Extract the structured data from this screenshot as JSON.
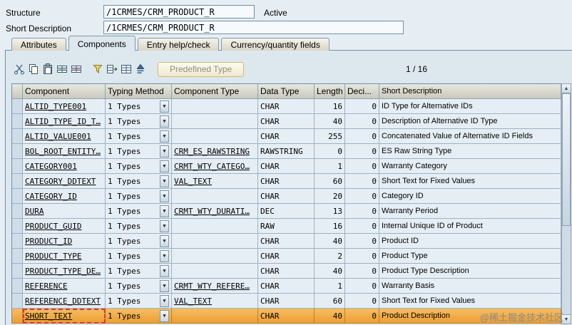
{
  "form": {
    "structure_label": "Structure",
    "structure_value": "/1CRMES/CRM_PRODUCT_R",
    "status": "Active",
    "short_description_label": "Short Description",
    "short_description_value": "/1CRMES/CRM_PRODUCT_R"
  },
  "tabs": [
    {
      "label": "Attributes",
      "active": false
    },
    {
      "label": "Components",
      "active": true
    },
    {
      "label": "Entry help/check",
      "active": false
    },
    {
      "label": "Currency/quantity fields",
      "active": false
    }
  ],
  "toolbar": {
    "icons_edit": [
      "cut-icon",
      "copy-icon",
      "paste-icon",
      "insert-row-icon",
      "delete-row-icon"
    ],
    "icons_view": [
      "filter-icon",
      "table-expand-icon",
      "table-icon",
      "sort-ascending-icon"
    ],
    "predefined_type_label": "Predefined Type",
    "position_indicator": "1 / 16"
  },
  "table": {
    "columns": [
      "Component",
      "Typing Method",
      "Component Type",
      "Data Type",
      "Length",
      "Deci...",
      "Short Description"
    ],
    "rows": [
      {
        "component": "ALTID_TYPE001",
        "typing": "1 Types",
        "component_type": "",
        "data_type": "CHAR",
        "length": "16",
        "decimals": "0",
        "description": "ID Type for Alternative IDs"
      },
      {
        "component": "ALTID_TYPE_ID_T…",
        "typing": "1 Types",
        "component_type": "",
        "data_type": "CHAR",
        "length": "40",
        "decimals": "0",
        "description": "Description of Alternative ID Type"
      },
      {
        "component": "ALTID_VALUE001",
        "typing": "1 Types",
        "component_type": "",
        "data_type": "CHAR",
        "length": "255",
        "decimals": "0",
        "description": "Concatenated Value of Alternative ID Fields"
      },
      {
        "component": "BOL_ROOT_ENTITY…",
        "typing": "1 Types",
        "component_type": "CRM_ES_RAWSTRING",
        "data_type": "RAWSTRING",
        "length": "0",
        "decimals": "0",
        "description": "ES Raw String Type"
      },
      {
        "component": "CATEGORY001",
        "typing": "1 Types",
        "component_type": "CRMT_WTY_CATEGO…",
        "data_type": "CHAR",
        "length": "1",
        "decimals": "0",
        "description": "Warranty Category"
      },
      {
        "component": "CATEGORY_DDTEXT",
        "typing": "1 Types",
        "component_type": "VAL_TEXT",
        "data_type": "CHAR",
        "length": "60",
        "decimals": "0",
        "description": "Short Text for Fixed Values"
      },
      {
        "component": "CATEGORY_ID",
        "typing": "1 Types",
        "component_type": "",
        "data_type": "CHAR",
        "length": "20",
        "decimals": "0",
        "description": "Category ID"
      },
      {
        "component": "DURA",
        "typing": "1 Types",
        "component_type": "CRMT_WTY_DURATI…",
        "data_type": "DEC",
        "length": "13",
        "decimals": "0",
        "description": "Warranty Period"
      },
      {
        "component": "PRODUCT_GUID",
        "typing": "1 Types",
        "component_type": "",
        "data_type": "RAW",
        "length": "16",
        "decimals": "0",
        "description": "Internal Unique ID of Product"
      },
      {
        "component": "PRODUCT_ID",
        "typing": "1 Types",
        "component_type": "",
        "data_type": "CHAR",
        "length": "40",
        "decimals": "0",
        "description": "Product ID"
      },
      {
        "component": "PRODUCT_TYPE",
        "typing": "1 Types",
        "component_type": "",
        "data_type": "CHAR",
        "length": "2",
        "decimals": "0",
        "description": "Product Type"
      },
      {
        "component": "PRODUCT_TYPE_DE…",
        "typing": "1 Types",
        "component_type": "",
        "data_type": "CHAR",
        "length": "40",
        "decimals": "0",
        "description": "Product Type Description"
      },
      {
        "component": "REFERENCE",
        "typing": "1 Types",
        "component_type": "CRMT_WTY_REFERE…",
        "data_type": "CHAR",
        "length": "1",
        "decimals": "0",
        "description": "Warranty Basis"
      },
      {
        "component": "REFERENCE_DDTEXT",
        "typing": "1 Types",
        "component_type": "VAL_TEXT",
        "data_type": "CHAR",
        "length": "60",
        "decimals": "0",
        "description": "Short Text for Fixed Values"
      },
      {
        "component": "SHORT_TEXT",
        "typing": "1 Types",
        "component_type": "",
        "data_type": "CHAR",
        "length": "40",
        "decimals": "0",
        "description": "Product Description",
        "selected": true
      }
    ]
  },
  "watermark": "@稀土掘金技术社区"
}
